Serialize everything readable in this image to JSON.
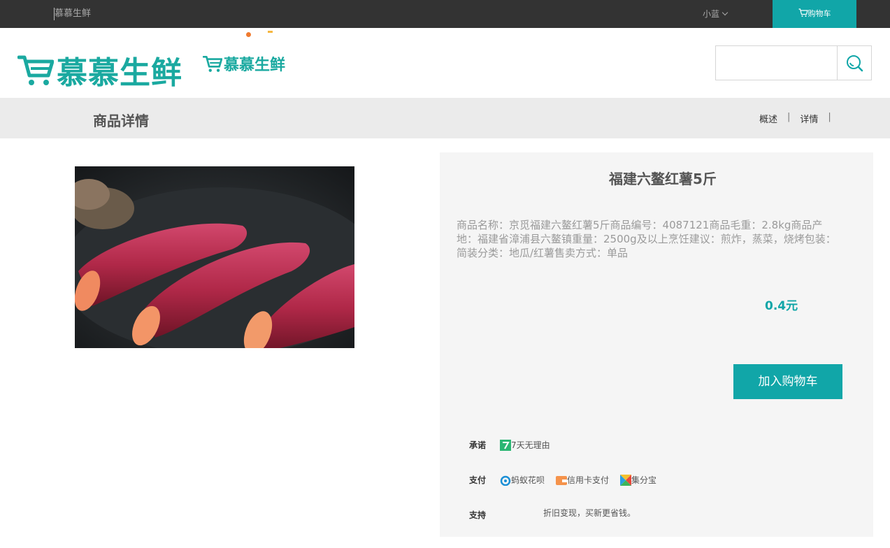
{
  "topbar": {
    "site_name": "慕慕生鲜",
    "user_name": "小蓝",
    "cart_label": "购物车"
  },
  "logo": {
    "text": "慕慕生鲜",
    "brand_color": "#1aa9a0"
  },
  "search": {
    "placeholder": ""
  },
  "subnav": {
    "title": "商品详情",
    "links": [
      "概述",
      "详情"
    ]
  },
  "product": {
    "name": "福建六鳌红薯5斤",
    "description": "商品名称：京觅福建六鳌红薯5斤商品编号：4087121商品毛重：2.8kg商品产地：福建省漳浦县六鳌镇重量：2500g及以上烹饪建议：煎炸，蒸菜，烧烤包装：简装分类：地瓜/红薯售卖方式：单品",
    "price": "0.4元",
    "add_to_cart": "加入购物车"
  },
  "services": {
    "promise_label": "承诺",
    "promise_items": [
      {
        "icon": "seven-day-icon",
        "text": "7天无理由"
      }
    ],
    "pay_label": "支付",
    "pay_items": [
      {
        "icon": "ant-huabei-icon",
        "text": "蚂蚁花呗"
      },
      {
        "icon": "credit-card-icon",
        "text": "信用卡支付"
      },
      {
        "icon": "jifenbao-icon",
        "text": "集分宝"
      }
    ],
    "support_label": "支持",
    "support_text": "折旧变现，买新更省钱。"
  },
  "colors": {
    "accent": "#11a6a8",
    "topbar_bg": "#333333",
    "subnav_bg": "#ebebeb",
    "panel_bg": "#f5f5f5"
  }
}
